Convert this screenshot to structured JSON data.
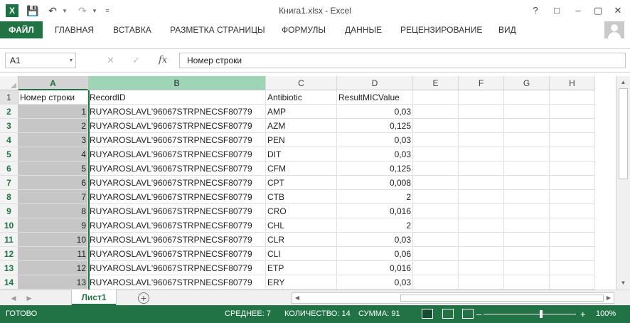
{
  "window": {
    "title": "Книга1.xlsx - Excel",
    "help": "?",
    "minimize": "–",
    "restore": "□",
    "maximize": "▢",
    "close": "✕"
  },
  "qat": {
    "app_glyph": "X",
    "save": "💾",
    "undo": "↶",
    "undo_dd": "▾",
    "redo": "↷",
    "redo_dd": "▾",
    "customize": "≡"
  },
  "ribbon": {
    "file": "ФАЙЛ",
    "tabs": [
      "ГЛАВНАЯ",
      "ВСТАВКА",
      "РАЗМЕТКА СТРАНИЦЫ",
      "ФОРМУЛЫ",
      "ДАННЫЕ",
      "РЕЦЕНЗИРОВАНИЕ",
      "ВИД"
    ]
  },
  "formula_bar": {
    "name_box": "A1",
    "name_box_dd": "▾",
    "cancel": "✕",
    "enter": "✓",
    "fx": "fx",
    "content": "Номер строки"
  },
  "columns": [
    "A",
    "B",
    "C",
    "D",
    "E",
    "F",
    "G",
    "H"
  ],
  "headers": {
    "a": "Номер строки",
    "b": "RecordID",
    "c": "Antibiotic",
    "d": "ResultMICValue"
  },
  "row_numbers": [
    "1",
    "2",
    "3",
    "4",
    "5",
    "6",
    "7",
    "8",
    "9",
    "10",
    "11",
    "12",
    "13",
    "14"
  ],
  "rows": [
    {
      "a": "1",
      "b": "RUYAROSLAVL'96067STRPNECSF80779",
      "c": "AMP",
      "d": "0,03"
    },
    {
      "a": "2",
      "b": "RUYAROSLAVL'96067STRPNECSF80779",
      "c": "AZM",
      "d": "0,125"
    },
    {
      "a": "3",
      "b": "RUYAROSLAVL'96067STRPNECSF80779",
      "c": "PEN",
      "d": "0,03"
    },
    {
      "a": "4",
      "b": "RUYAROSLAVL'96067STRPNECSF80779",
      "c": "DIT",
      "d": "0,03"
    },
    {
      "a": "5",
      "b": "RUYAROSLAVL'96067STRPNECSF80779",
      "c": "CFM",
      "d": "0,125"
    },
    {
      "a": "6",
      "b": "RUYAROSLAVL'96067STRPNECSF80779",
      "c": "CPT",
      "d": "0,008"
    },
    {
      "a": "7",
      "b": "RUYAROSLAVL'96067STRPNECSF80779",
      "c": "CTB",
      "d": "2"
    },
    {
      "a": "8",
      "b": "RUYAROSLAVL'96067STRPNECSF80779",
      "c": "CRO",
      "d": "0,016"
    },
    {
      "a": "9",
      "b": "RUYAROSLAVL'96067STRPNECSF80779",
      "c": "CHL",
      "d": "2"
    },
    {
      "a": "10",
      "b": "RUYAROSLAVL'96067STRPNECSF80779",
      "c": "CLR",
      "d": "0,03"
    },
    {
      "a": "11",
      "b": "RUYAROSLAVL'96067STRPNECSF80779",
      "c": "CLI",
      "d": "0,06"
    },
    {
      "a": "12",
      "b": "RUYAROSLAVL'96067STRPNECSF80779",
      "c": "ETP",
      "d": "0,016"
    },
    {
      "a": "13",
      "b": "RUYAROSLAVL'96067STRPNECSF80779",
      "c": "ERY",
      "d": "0,03"
    }
  ],
  "sheets": {
    "active": "Лист1",
    "add": "+",
    "nav_prev": "◀",
    "nav_next": "▶"
  },
  "scroll": {
    "up": "▲",
    "down": "▼",
    "left": "◀",
    "right": "▶"
  },
  "status": {
    "ready": "ГОТОВО",
    "average": "СРЕДНЕЕ: 7",
    "count": "КОЛИЧЕСТВО: 14",
    "sum": "СУММА: 91",
    "zoom_minus": "–",
    "zoom_plus": "+",
    "zoom": "100%"
  },
  "colors": {
    "accent": "#217346",
    "selected_header": "#9fd5b7"
  }
}
